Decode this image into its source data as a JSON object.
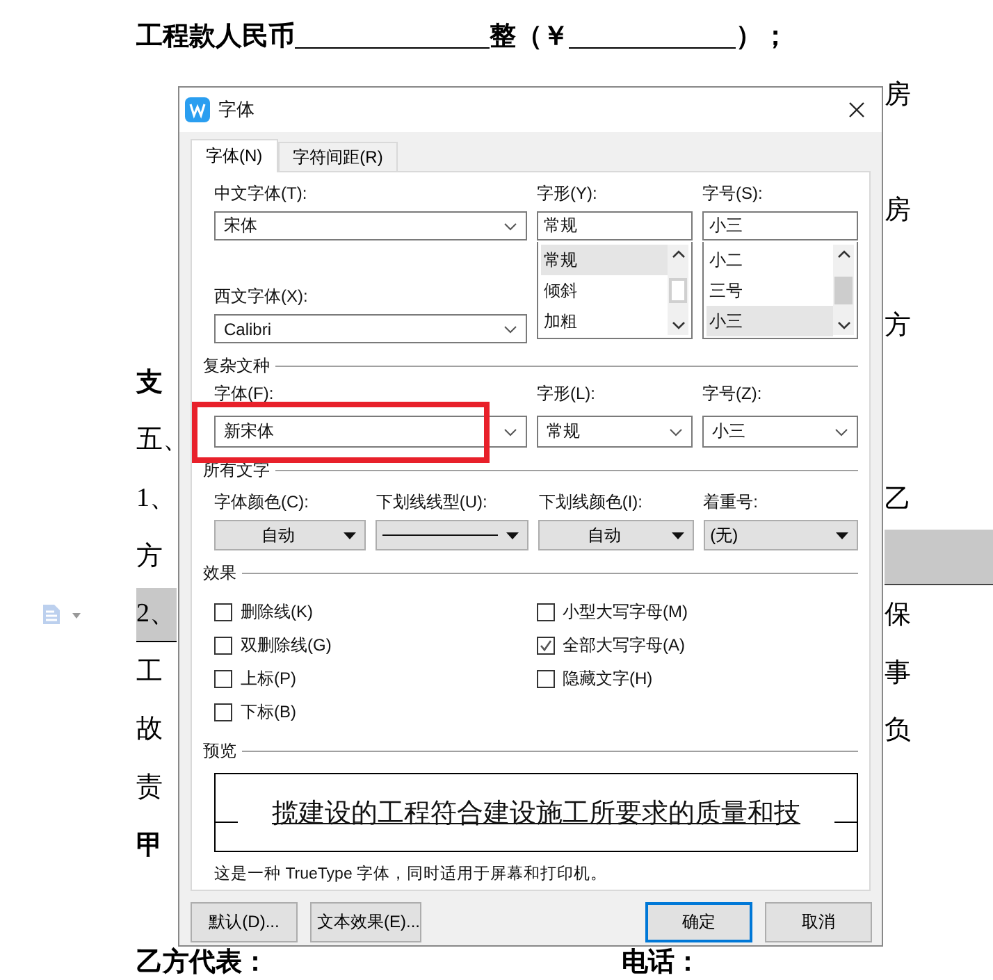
{
  "document": {
    "first_line": {
      "parts": [
        "工程款人民币",
        "整（￥",
        "）；"
      ]
    },
    "right_fragments_top": [
      "房",
      "房",
      "方"
    ],
    "left_fragments": [
      {
        "text": "支",
        "bold": true,
        "highlighted": false
      },
      {
        "text": "五、",
        "bold": false,
        "highlighted": false
      },
      {
        "text": "1、",
        "bold": false,
        "highlighted": false
      },
      {
        "text": "方",
        "bold": false,
        "highlighted": false
      },
      {
        "text": "2、",
        "bold": false,
        "highlighted": true
      },
      {
        "text": "工",
        "bold": false,
        "highlighted": false
      },
      {
        "text": "故",
        "bold": false,
        "highlighted": false
      },
      {
        "text": "责",
        "bold": false,
        "highlighted": false
      },
      {
        "text": "甲",
        "bold": true,
        "highlighted": false
      }
    ],
    "right_fragments": [
      {
        "kind": "text",
        "text": "乙"
      },
      {
        "kind": "highlight"
      },
      {
        "kind": "text",
        "text": "保"
      },
      {
        "kind": "text",
        "text": "事"
      },
      {
        "kind": "text",
        "text": "负"
      }
    ],
    "signature": {
      "party": "乙方代表：",
      "phone": "电话："
    }
  },
  "dialog": {
    "title": "字体",
    "tabs": [
      {
        "label": "字体(N)",
        "selected": true
      },
      {
        "label": "字符间距(R)",
        "selected": false
      }
    ],
    "chinese_font": {
      "label": "中文字体(T):",
      "value": "宋体"
    },
    "style": {
      "label": "字形(Y):",
      "value": "常规",
      "options": [
        {
          "label": "常规",
          "selected": true
        },
        {
          "label": "倾斜",
          "selected": false
        },
        {
          "label": "加粗",
          "selected": false
        }
      ]
    },
    "size": {
      "label": "字号(S):",
      "value": "小三",
      "options": [
        {
          "label": "小二",
          "selected": false
        },
        {
          "label": "三号",
          "selected": false
        },
        {
          "label": "小三",
          "selected": true
        }
      ]
    },
    "western_font": {
      "label": "西文字体(X):",
      "value": "Calibri"
    },
    "complex_script": {
      "title": "复杂文种",
      "font": {
        "label": "字体(F):",
        "value": "新宋体"
      },
      "style": {
        "label": "字形(L):",
        "value": "常规"
      },
      "size": {
        "label": "字号(Z):",
        "value": "小三"
      }
    },
    "all_text": {
      "title": "所有文字",
      "fields": [
        {
          "label": "字体颜色(C):",
          "value": "自动",
          "kind": "button"
        },
        {
          "label": "下划线线型(U):",
          "kind": "line"
        },
        {
          "label": "下划线颜色(I):",
          "value": "自动",
          "kind": "button"
        },
        {
          "label": "着重号:",
          "value": "(无)",
          "kind": "list"
        }
      ]
    },
    "effects": {
      "title": "效果",
      "column_1": [
        {
          "label": "删除线(K)",
          "checked": false
        },
        {
          "label": "双删除线(G)",
          "checked": false
        },
        {
          "label": "上标(P)",
          "checked": false
        },
        {
          "label": "下标(B)",
          "checked": false
        }
      ],
      "column_2": [
        {
          "label": "小型大写字母(M)",
          "checked": false
        },
        {
          "label": "全部大写字母(A)",
          "checked": true
        },
        {
          "label": "隐藏文字(H)",
          "checked": false
        }
      ]
    },
    "preview": {
      "title": "预览",
      "sample": "揽建设的工程符合建设施工所要求的质量和技",
      "note": "这是一种 TrueType 字体，同时适用于屏幕和打印机。"
    },
    "buttons": [
      {
        "label": "默认(D)...",
        "kind": "plain"
      },
      {
        "label": "文本效果(E)...",
        "kind": "plain"
      },
      {
        "label": "确定",
        "kind": "default"
      },
      {
        "label": "取消",
        "kind": "plain"
      }
    ]
  },
  "annotation": {
    "kind": "box"
  }
}
